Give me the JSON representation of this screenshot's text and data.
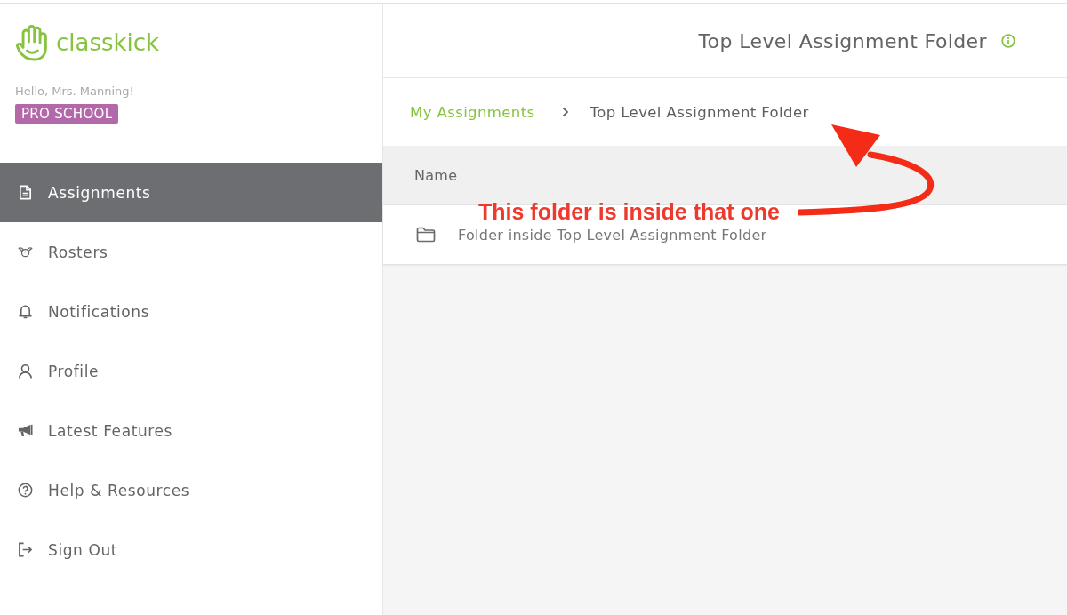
{
  "sidebar": {
    "logo": {
      "text": "classkick"
    },
    "greeting": "Hello, Mrs. Manning!",
    "badge": "PRO SCHOOL",
    "items": [
      {
        "label": "Assignments",
        "selected": true
      },
      {
        "label": "Rosters",
        "selected": false
      },
      {
        "label": "Notifications",
        "selected": false
      },
      {
        "label": "Profile",
        "selected": false
      },
      {
        "label": "Latest Features",
        "selected": false
      },
      {
        "label": "Help & Resources",
        "selected": false
      },
      {
        "label": "Sign Out",
        "selected": false
      }
    ]
  },
  "header": {
    "title": "Top Level Assignment Folder"
  },
  "breadcrumb": [
    {
      "label": "My Assignments",
      "current": false
    },
    {
      "label": "Top Level Assignment Folder",
      "current": true
    }
  ],
  "table": {
    "columns": [
      "Name"
    ],
    "rows": [
      {
        "name": "Folder inside Top Level Assignment Folder"
      }
    ]
  },
  "annotation": {
    "text": "This folder is inside that one"
  }
}
